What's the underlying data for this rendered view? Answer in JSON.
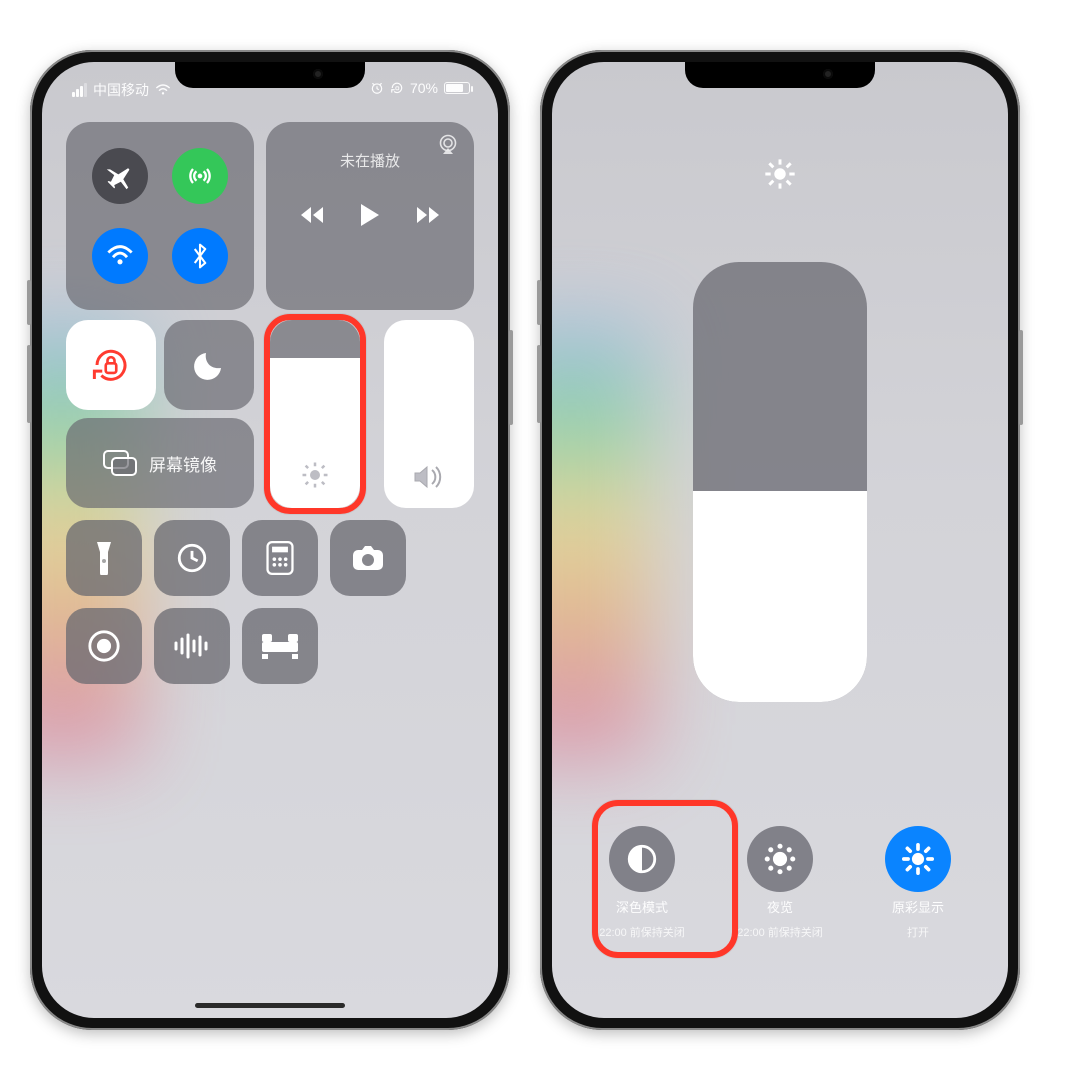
{
  "status": {
    "carrier": "中国移动",
    "battery_text": "70%",
    "battery_level": 70
  },
  "media": {
    "title": "未在播放"
  },
  "mirror": {
    "label": "屏幕镜像"
  },
  "right": {
    "dark": {
      "title": "深色模式",
      "subtitle": "22:00 前保持关闭"
    },
    "night": {
      "title": "夜览",
      "subtitle": "22:00 前保持关闭"
    },
    "true_tone": {
      "title": "原彩显示",
      "subtitle": "打开"
    }
  },
  "icons": {
    "alarm": "⏰",
    "lock": "🔒"
  }
}
